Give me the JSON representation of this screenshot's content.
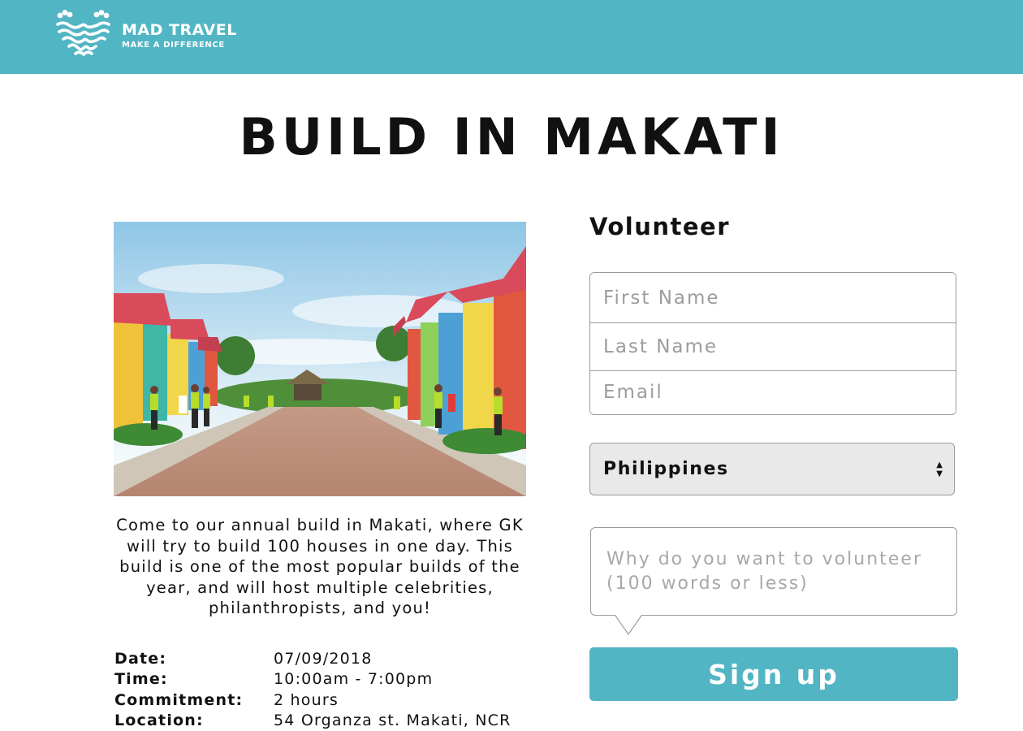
{
  "brand": {
    "name": "MAD TRAVEL",
    "tagline": "MAKE A DIFFERENCE",
    "accent_color": "#52b5c3",
    "logo_icon": "heart-waves-icon"
  },
  "event": {
    "title": "BUILD IN MAKATI",
    "description": "Come to our annual build in Makati, where GK will try to build 100 houses in one day. This build is one of the most popular builds of the year, and will host multiple celebrities, philanthropists, and you!",
    "details": [
      {
        "label": "Date:",
        "value": "07/09/2018"
      },
      {
        "label": "Time:",
        "value": "10:00am - 7:00pm"
      },
      {
        "label": "Commitment:",
        "value": "2 hours"
      },
      {
        "label": "Location:",
        "value": "54 Organza st. Makati, NCR"
      }
    ]
  },
  "form": {
    "heading": "Volunteer",
    "first_name_placeholder": "First Name",
    "last_name_placeholder": "Last Name",
    "email_placeholder": "Email",
    "country_selected": "Philippines",
    "reason_placeholder": "Why do you want to volunteer (100 words or less)",
    "submit_label": "Sign up"
  }
}
